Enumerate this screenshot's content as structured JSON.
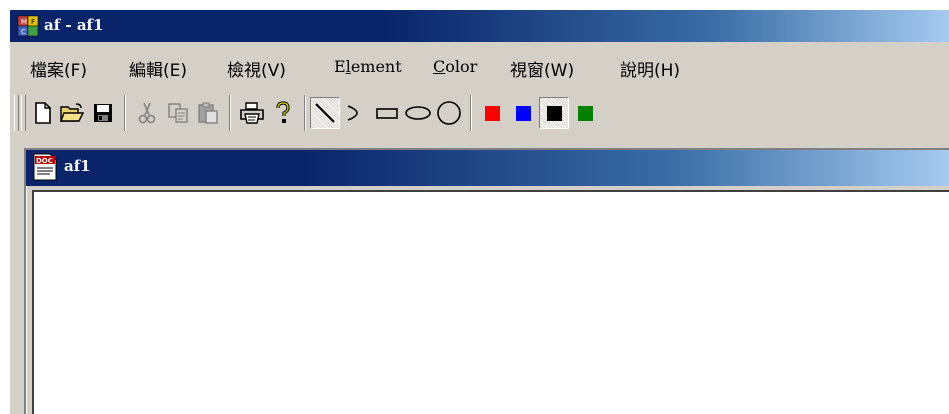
{
  "window": {
    "title": "af - af1",
    "icon": "mfc-app-icon"
  },
  "menu": [
    {
      "id": "file",
      "label": "檔案(F)",
      "latin": false
    },
    {
      "id": "edit",
      "label": "編輯(E)",
      "latin": false
    },
    {
      "id": "view",
      "label": "檢視(V)",
      "latin": false
    },
    {
      "id": "element",
      "label": "Element",
      "latin": true
    },
    {
      "id": "color",
      "label": "Color",
      "latin": true
    },
    {
      "id": "window",
      "label": "視窗(W)",
      "latin": false
    },
    {
      "id": "help",
      "label": "說明(H)",
      "latin": false
    }
  ],
  "toolbar": {
    "buttons": [
      "new-file-icon",
      "open-folder-icon",
      "save-disk-icon",
      "cut-icon",
      "copy-icon",
      "paste-icon",
      "print-icon",
      "help-question-icon",
      "line-tool-icon",
      "curve-tool-icon",
      "rectangle-tool-icon",
      "ellipse-tool-icon",
      "circle-tool-icon"
    ],
    "colors": [
      {
        "name": "red",
        "hex": "#ff0000",
        "selected": false
      },
      {
        "name": "blue",
        "hex": "#0000ff",
        "selected": false
      },
      {
        "name": "black",
        "hex": "#000000",
        "selected": true
      },
      {
        "name": "green",
        "hex": "#008000",
        "selected": false
      }
    ],
    "selected_tool": "line-tool-icon"
  },
  "document": {
    "title": "af1",
    "icon": "doc-icon"
  },
  "colors": {
    "title_active": "#0a246a",
    "title_gradient_end": "#a6caf0",
    "face": "#d4d0c8"
  }
}
